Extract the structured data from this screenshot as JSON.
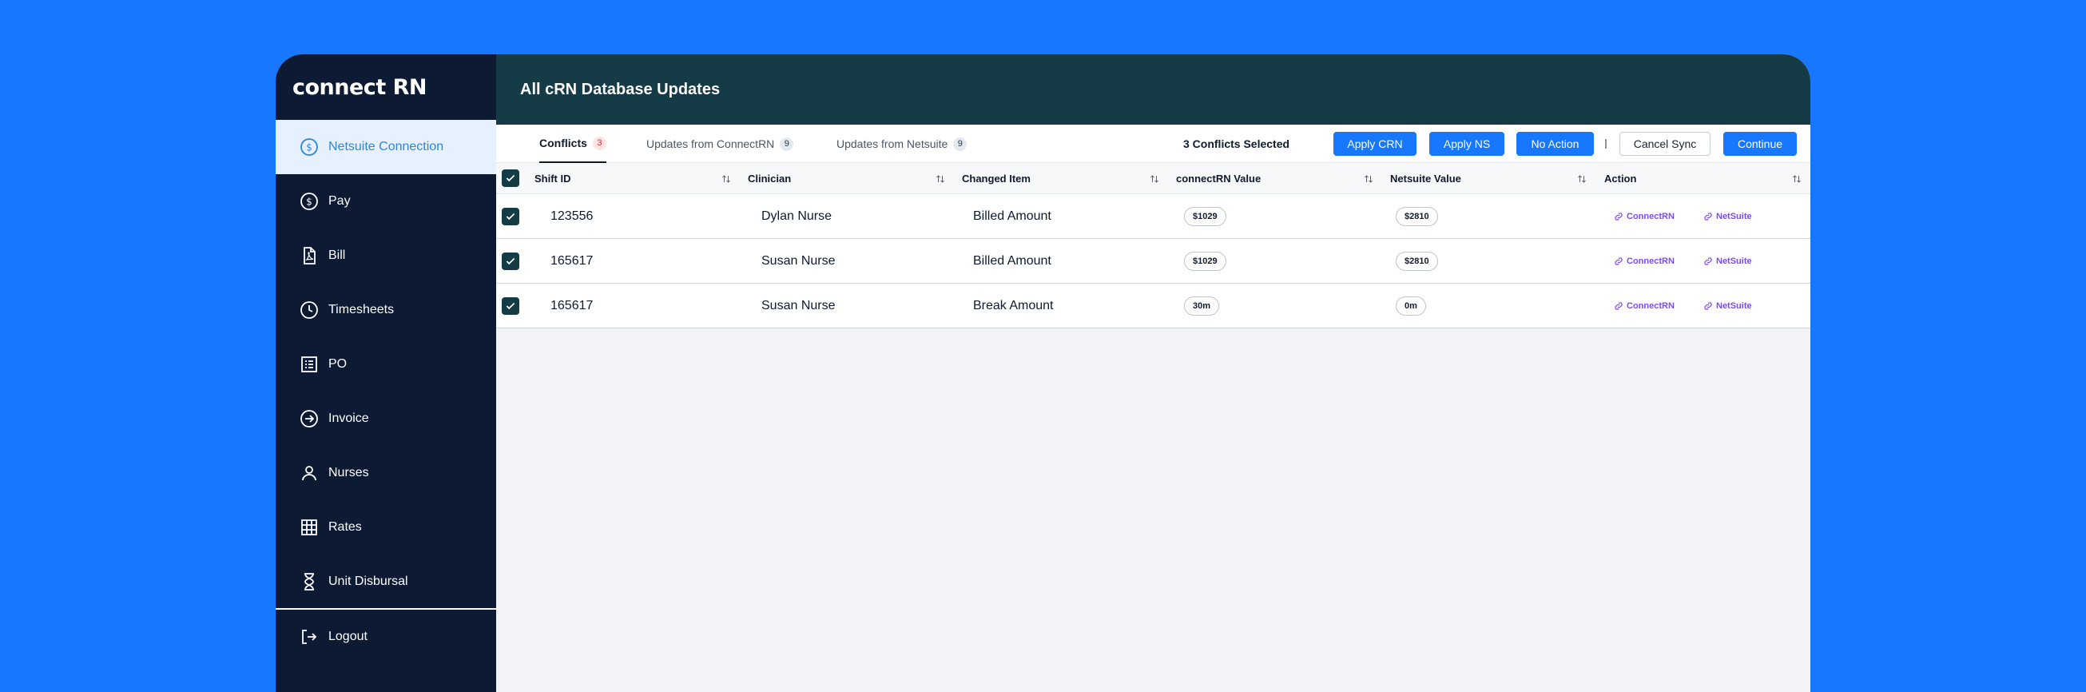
{
  "app": {
    "logo_text": "connect RN"
  },
  "sidebar": {
    "items": [
      {
        "label": "Netsuite Connection",
        "icon": "dollar-circle-icon",
        "active": true
      },
      {
        "label": "Pay",
        "icon": "dollar-circle-icon"
      },
      {
        "label": "Bill",
        "icon": "pdf-file-icon"
      },
      {
        "label": "Timesheets",
        "icon": "clock-icon"
      },
      {
        "label": "PO",
        "icon": "list-document-icon"
      },
      {
        "label": "Invoice",
        "icon": "arrow-circle-icon"
      },
      {
        "label": "Nurses",
        "icon": "person-icon"
      },
      {
        "label": "Rates",
        "icon": "grid-icon"
      },
      {
        "label": "Unit Disbursal",
        "icon": "hourglass-icon"
      }
    ],
    "logout_label": "Logout"
  },
  "header": {
    "title": "All cRN Database Updates"
  },
  "tabs": [
    {
      "label": "Conflicts",
      "count": "3",
      "active": true
    },
    {
      "label": "Updates from ConnectRN",
      "count": "9"
    },
    {
      "label": "Updates from Netsuite",
      "count": "9"
    }
  ],
  "toolbar": {
    "selected_text": "3 Conflicts Selected",
    "apply_crn": "Apply CRN",
    "apply_ns": "Apply NS",
    "no_action": "No Action",
    "cancel_sync": "Cancel Sync",
    "continue": "Continue"
  },
  "table": {
    "columns": [
      "Shift ID",
      "Clinician",
      "Changed Item",
      "connectRN Value",
      "Netsuite Value",
      "Action"
    ],
    "rows": [
      {
        "shift_id": "123556",
        "clinician": "Dylan Nurse",
        "changed_item": "Billed Amount",
        "crn_value": "$1029",
        "ns_value": "$2810",
        "action_crn": "ConnectRN",
        "action_ns": "NetSuite",
        "checked": true
      },
      {
        "shift_id": "165617",
        "clinician": "Susan Nurse",
        "changed_item": "Billed Amount",
        "crn_value": "$1029",
        "ns_value": "$2810",
        "action_crn": "ConnectRN",
        "action_ns": "NetSuite",
        "checked": true
      },
      {
        "shift_id": "165617",
        "clinician": "Susan Nurse",
        "changed_item": "Break Amount",
        "crn_value": "30m",
        "ns_value": "0m",
        "action_crn": "ConnectRN",
        "action_ns": "NetSuite",
        "checked": true
      }
    ]
  },
  "colors": {
    "background": "#1778FF",
    "sidebar": "#0C1A33",
    "header": "#153B46",
    "accent": "#1778FF",
    "link": "#7B4BFF",
    "checkbox": "#133B46",
    "conflict_badge": "#D93025"
  }
}
